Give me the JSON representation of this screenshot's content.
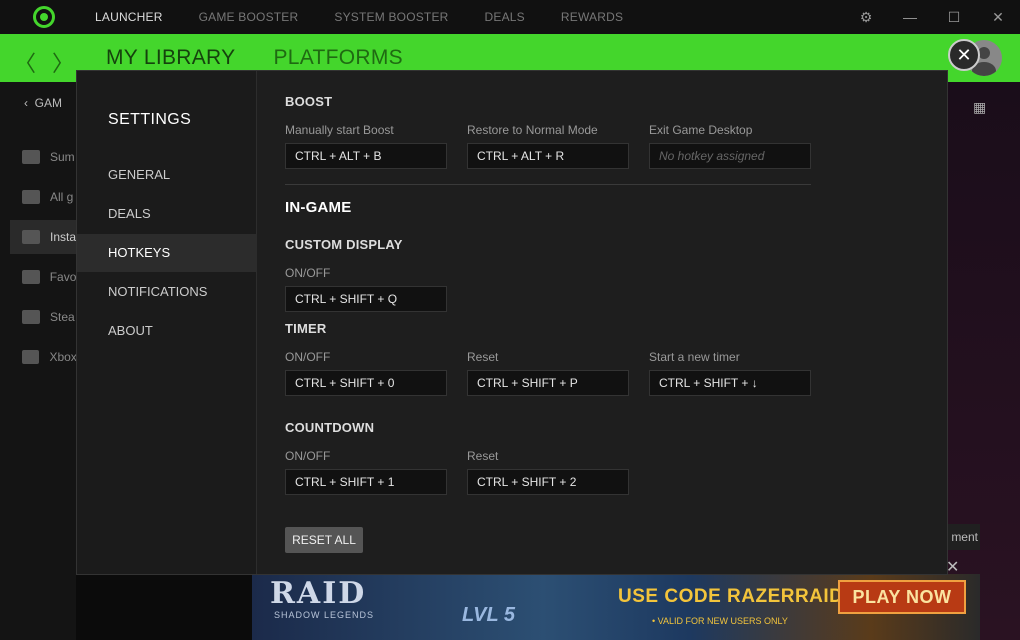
{
  "titlebar": {
    "nav": [
      "LAUNCHER",
      "GAME BOOSTER",
      "SYSTEM BOOSTER",
      "DEALS",
      "REWARDS"
    ],
    "active": "LAUNCHER"
  },
  "greenbar": {
    "back": "〈",
    "forward": "〉",
    "tabs": [
      "MY LIBRARY",
      "PLATFORMS"
    ]
  },
  "bg_sidebar": {
    "back_label": "GAM",
    "items": [
      "Sum",
      "All g",
      "Insta",
      "Favo",
      "Stea",
      "Xbox"
    ],
    "selected_index": 2
  },
  "bg_right": {
    "ment": "ment"
  },
  "ad": {
    "raid": "RAID",
    "raid_sub": "SHADOW LEGENDS",
    "lvl": "LVL 5",
    "code": "USE CODE RAZERRAID22",
    "valid": "• VALID FOR NEW USERS ONLY",
    "play": "PLAY NOW"
  },
  "settings": {
    "title": "SETTINGS",
    "nav": [
      "GENERAL",
      "DEALS",
      "HOTKEYS",
      "NOTIFICATIONS",
      "ABOUT"
    ],
    "active_nav": "HOTKEYS",
    "boost": {
      "heading": "BOOST",
      "manual_label": "Manually start Boost",
      "manual_value": "CTRL + ALT + B",
      "restore_label": "Restore to Normal Mode",
      "restore_value": "CTRL + ALT + R",
      "exit_label": "Exit Game Desktop",
      "exit_placeholder": "No hotkey assigned"
    },
    "ingame": {
      "heading": "IN-GAME",
      "custom_display": {
        "heading": "CUSTOM DISPLAY",
        "onoff_label": "ON/OFF",
        "onoff_value": "CTRL + SHIFT + Q"
      },
      "timer": {
        "heading": "TIMER",
        "onoff_label": "ON/OFF",
        "onoff_value": "CTRL + SHIFT + 0",
        "reset_label": "Reset",
        "reset_value": "CTRL + SHIFT + P",
        "new_label": "Start a new timer",
        "new_value": "CTRL + SHIFT + ↓"
      },
      "countdown": {
        "heading": "COUNTDOWN",
        "onoff_label": "ON/OFF",
        "onoff_value": "CTRL + SHIFT + 1",
        "reset_label": "Reset",
        "reset_value": "CTRL + SHIFT + 2"
      }
    },
    "reset_all": "RESET ALL"
  }
}
